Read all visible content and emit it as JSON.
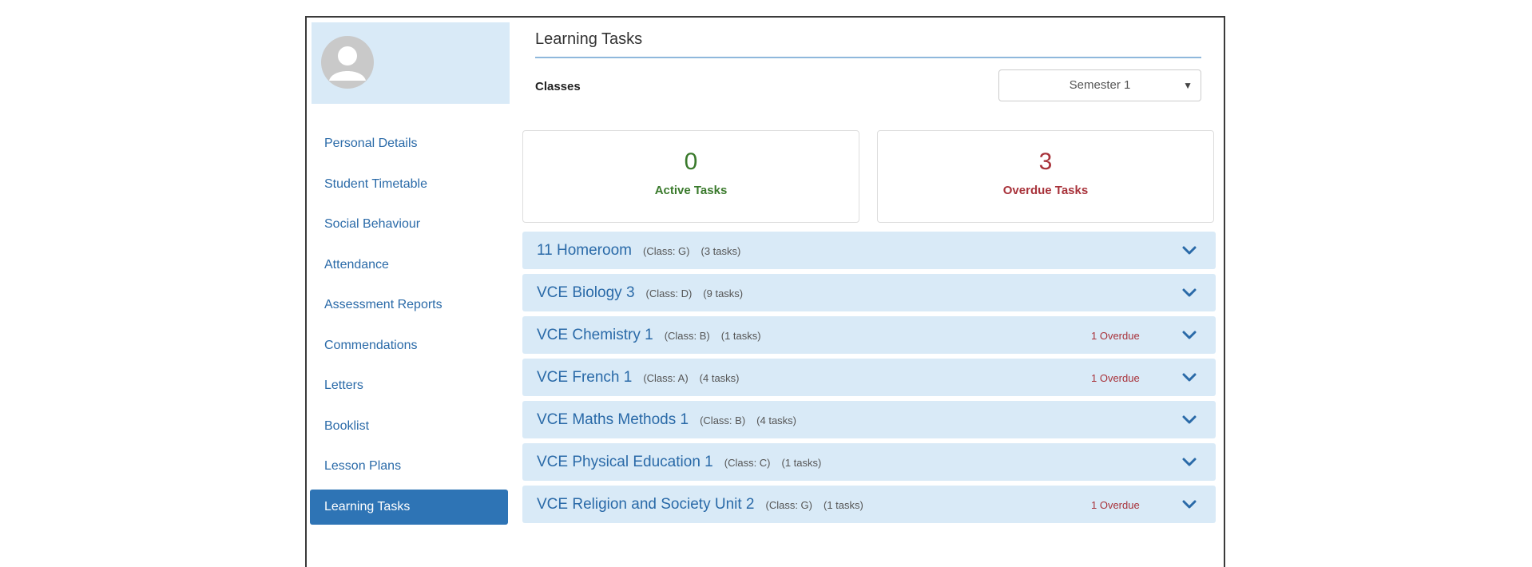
{
  "header": {
    "title": "Learning Tasks",
    "classes_label": "Classes"
  },
  "semester_select": {
    "value": "Semester 1"
  },
  "sidebar": {
    "items": [
      {
        "label": "Personal Details"
      },
      {
        "label": "Student Timetable"
      },
      {
        "label": "Social Behaviour"
      },
      {
        "label": "Attendance"
      },
      {
        "label": "Assessment Reports"
      },
      {
        "label": "Commendations"
      },
      {
        "label": "Letters"
      },
      {
        "label": "Booklist"
      },
      {
        "label": "Lesson Plans"
      },
      {
        "label": "Learning Tasks"
      }
    ]
  },
  "stats": {
    "active": {
      "value": "0",
      "label": "Active Tasks"
    },
    "overdue": {
      "value": "3",
      "label": "Overdue Tasks"
    }
  },
  "classes": [
    {
      "name": "11 Homeroom",
      "class_code": "(Class: G)",
      "tasks": "(3 tasks)",
      "overdue": ""
    },
    {
      "name": "VCE Biology 3",
      "class_code": "(Class: D)",
      "tasks": "(9 tasks)",
      "overdue": ""
    },
    {
      "name": "VCE Chemistry 1",
      "class_code": "(Class: B)",
      "tasks": "(1 tasks)",
      "overdue": "1 Overdue"
    },
    {
      "name": "VCE French 1",
      "class_code": "(Class: A)",
      "tasks": "(4 tasks)",
      "overdue": "1 Overdue"
    },
    {
      "name": "VCE Maths Methods 1",
      "class_code": "(Class: B)",
      "tasks": "(4 tasks)",
      "overdue": ""
    },
    {
      "name": "VCE Physical Education 1",
      "class_code": "(Class: C)",
      "tasks": "(1 tasks)",
      "overdue": ""
    },
    {
      "name": "VCE Religion and Society Unit 2",
      "class_code": "(Class: G)",
      "tasks": "(1 tasks)",
      "overdue": "1 Overdue"
    }
  ],
  "colors": {
    "accent": "#2e74b5",
    "panel": "#d9eaf7",
    "active_green": "#3a7a2c",
    "overdue_red": "#a8323a"
  }
}
